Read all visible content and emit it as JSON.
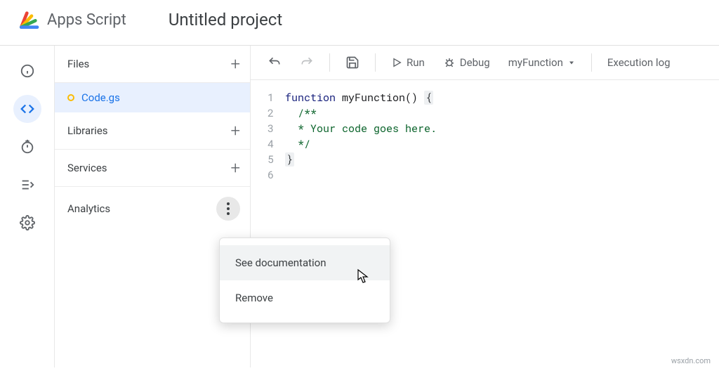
{
  "header": {
    "app_name": "Apps Script",
    "project_title": "Untitled project"
  },
  "sidebar": {
    "files_label": "Files",
    "file_name": "Code.gs",
    "libraries_label": "Libraries",
    "services_label": "Services",
    "analytics_label": "Analytics"
  },
  "toolbar": {
    "run_label": "Run",
    "debug_label": "Debug",
    "function_name": "myFunction",
    "exec_log": "Execution log"
  },
  "editor": {
    "lines": [
      "1",
      "2",
      "3",
      "4",
      "5",
      "6"
    ],
    "l1a": "function",
    "l1b": " myFunction() ",
    "l1c": "{",
    "l2": "  /**",
    "l3": "  * Your code goes here.",
    "l4": "  */",
    "l5": "}",
    "l6": ""
  },
  "popup": {
    "see_docs": "See documentation",
    "remove": "Remove"
  },
  "watermark": "wsxdn.com"
}
